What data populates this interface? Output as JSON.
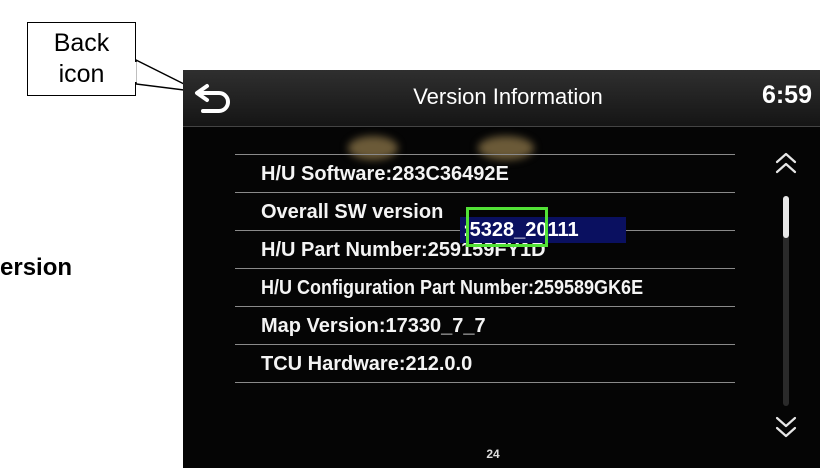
{
  "annotations": {
    "back_icon_callout": "Back\nicon",
    "side_label": "ersion"
  },
  "header": {
    "title": "Version Information",
    "clock": "6:59",
    "back_icon": "back-arrow-icon"
  },
  "rows": [
    {
      "label": "H/U Software:283C36492E"
    },
    {
      "label": "Overall SW version"
    },
    {
      "label": "H/U Part Number:259159FY1D"
    },
    {
      "label": "H/U Configuration Part Number:259589GK6E"
    },
    {
      "label": "Map Version:17330_7_7"
    },
    {
      "label": "TCU Hardware:212.0.0"
    }
  ],
  "highlight": {
    "value": ":5328_20111",
    "highlight_color": "#0a1060",
    "box_color": "#52e236"
  },
  "scroll": {
    "up_icon": "double-chevron-up-icon",
    "down_icon": "double-chevron-down-icon"
  },
  "page_number": "24"
}
